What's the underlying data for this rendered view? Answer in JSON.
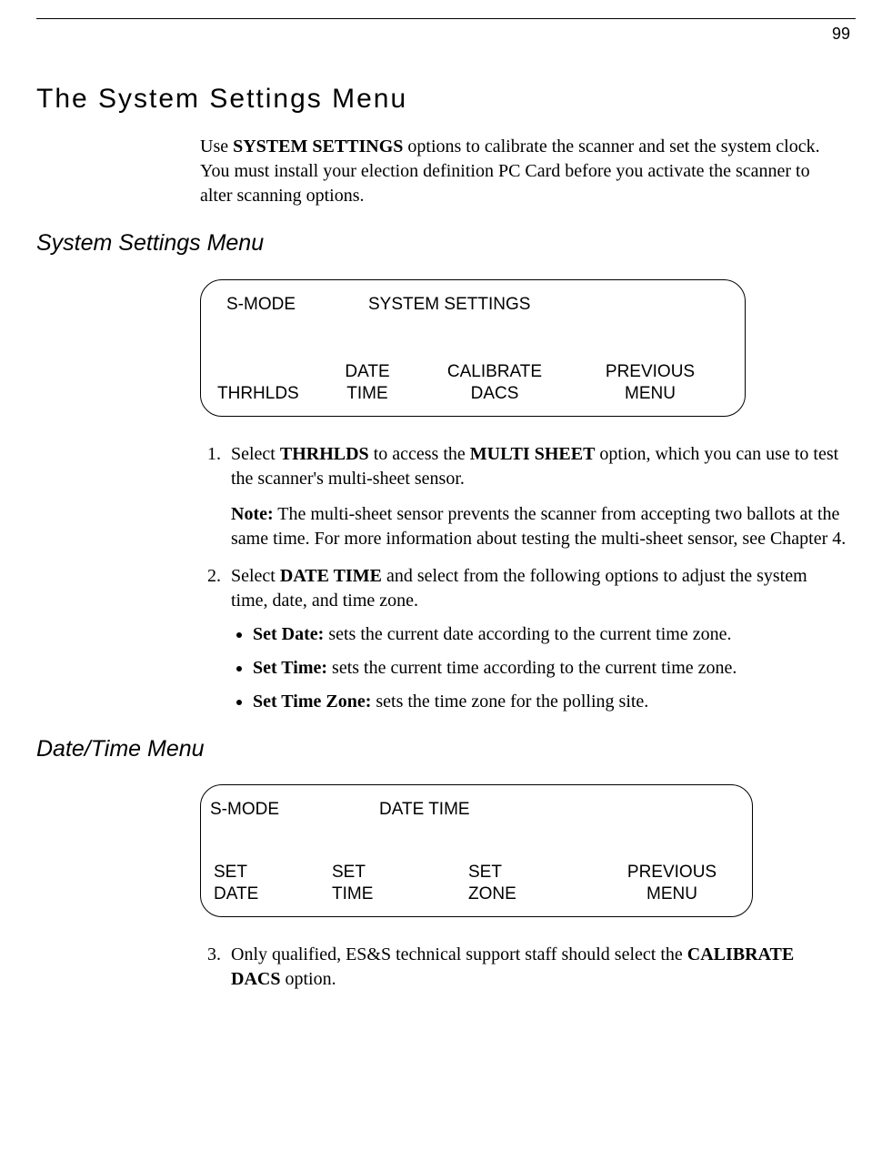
{
  "pageNumber": "99",
  "title": "The System Settings Menu",
  "intro": {
    "pre": "Use ",
    "bold": "SYSTEM SETTINGS",
    "post": " options to calibrate the scanner and set the system clock. You must install your election definition PC Card before you activate the scanner to alter scanning options."
  },
  "subsection1": "System Settings Menu",
  "panel1": {
    "mode": "S-MODE",
    "title": "SYSTEM SETTINGS",
    "options": {
      "c1": {
        "line2": "THRHLDS"
      },
      "c2": {
        "line1": "DATE",
        "line2": "TIME"
      },
      "c3": {
        "line1": "CALIBRATE",
        "line2": "DACS"
      },
      "c4": {
        "line1": "PREVIOUS",
        "line2": "MENU"
      }
    }
  },
  "step1": {
    "pre": "Select ",
    "b1": "THRHLDS",
    "mid": " to access the ",
    "b2": "MULTI SHEET",
    "post": " option, which you can use to test the scanner's multi-sheet sensor."
  },
  "note": {
    "label": "Note:",
    "text": "  The multi-sheet sensor prevents the scanner from accepting two ballots at the same time. For more information about testing the multi-sheet sensor, see Chapter 4."
  },
  "step2": {
    "pre": "Select ",
    "b1": "DATE TIME",
    "post": " and select from the following options to adjust the system time, date, and time zone."
  },
  "bullets": {
    "b1": {
      "label": "Set Date:",
      "text": " sets the current date according to the current time zone."
    },
    "b2": {
      "label": "Set Time:",
      "text": " sets the current time according to the current time zone."
    },
    "b3": {
      "label": "Set Time Zone:",
      "text": " sets the time zone for the polling site."
    }
  },
  "subsection2": "Date/Time Menu",
  "panel2": {
    "mode": "S-MODE",
    "title": "DATE TIME",
    "options": {
      "c1": {
        "line1": "SET",
        "line2": "DATE"
      },
      "c2": {
        "line1": "SET",
        "line2": "TIME"
      },
      "c3": {
        "line1": "SET",
        "line2": "ZONE"
      },
      "c4": {
        "line1": "PREVIOUS",
        "line2": "MENU"
      }
    }
  },
  "step3": {
    "pre": "Only qualified, ES&S technical support staff should select the ",
    "b1": "CALIBRATE DACS",
    "post": " option."
  }
}
